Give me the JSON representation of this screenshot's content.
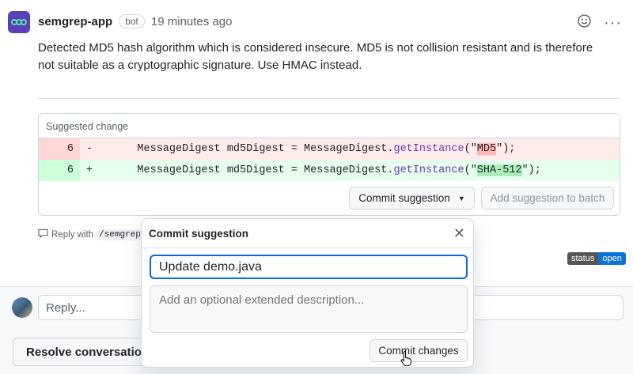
{
  "comment": {
    "author": "semgrep-app",
    "badge": "bot",
    "time": "19 minutes ago",
    "body": "Detected MD5 hash algorithm which is considered insecure. MD5 is not collision resistant and is therefore not suitable as a cryptographic signature. Use HMAC instead."
  },
  "suggestion": {
    "title": "Suggested change",
    "removed": {
      "line": "6",
      "sign": "-",
      "prefix": "    MessageDigest md5Digest = MessageDigest.",
      "fn": "getInstance",
      "open": "(\"",
      "highlight": "MD5",
      "close": "\");"
    },
    "added": {
      "line": "6",
      "sign": "+",
      "prefix": "    MessageDigest md5Digest = MessageDigest.",
      "fn": "getInstance",
      "open": "(\"",
      "highlight": "SHA-512",
      "close": "\");"
    },
    "commit_label": "Commit suggestion",
    "batch_label": "Add suggestion to batch"
  },
  "reply_hint": {
    "prefix": "Reply with",
    "command": "/semgrep i"
  },
  "status": {
    "key": "status",
    "value": "open"
  },
  "reply_placeholder": "Reply...",
  "resolve_label": "Resolve conversation",
  "popover": {
    "title": "Commit suggestion",
    "message_value": "Update demo.java",
    "description_placeholder": "Add an optional extended description...",
    "submit_label": "Commit changes"
  },
  "colors": {
    "accent": "#0969da",
    "app_avatar": "#5b3fb8",
    "status_open": "#0a73d8"
  }
}
